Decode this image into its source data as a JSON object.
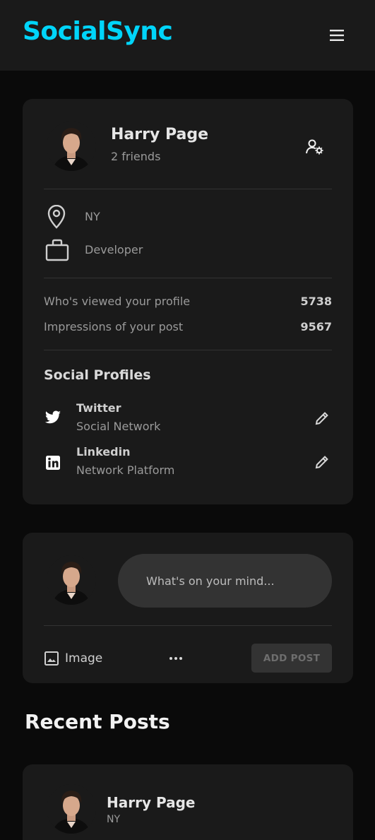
{
  "navbar": {
    "brand": "SocialSync",
    "brand_color": "#00d5fa",
    "menu_icon": "hamburger-menu-icon"
  },
  "profile": {
    "name": "Harry Page",
    "friends": "2 friends",
    "manage_icon": "user-settings-icon",
    "location": "NY",
    "location_icon": "location-pin-icon",
    "occupation": "Developer",
    "occupation_icon": "briefcase-icon",
    "stats": [
      {
        "label": "Who's viewed your profile",
        "value": "5738"
      },
      {
        "label": "Impressions of your post",
        "value": "9567"
      }
    ],
    "social_title": "Social Profiles",
    "social": [
      {
        "name": "Twitter",
        "desc": "Social Network",
        "icon": "twitter-icon",
        "edit_icon": "edit-pencil-icon"
      },
      {
        "name": "Linkedin",
        "desc": "Network Platform",
        "icon": "linkedin-icon",
        "edit_icon": "edit-pencil-icon"
      }
    ]
  },
  "composer": {
    "placeholder": "What's on your mind...",
    "image_label": "Image",
    "image_icon": "image-icon",
    "more_icon": "more-dots-icon",
    "add_post": "ADD POST"
  },
  "recent": {
    "title": "Recent Posts",
    "posts": [
      {
        "author": "Harry Page",
        "location": "NY"
      }
    ]
  }
}
